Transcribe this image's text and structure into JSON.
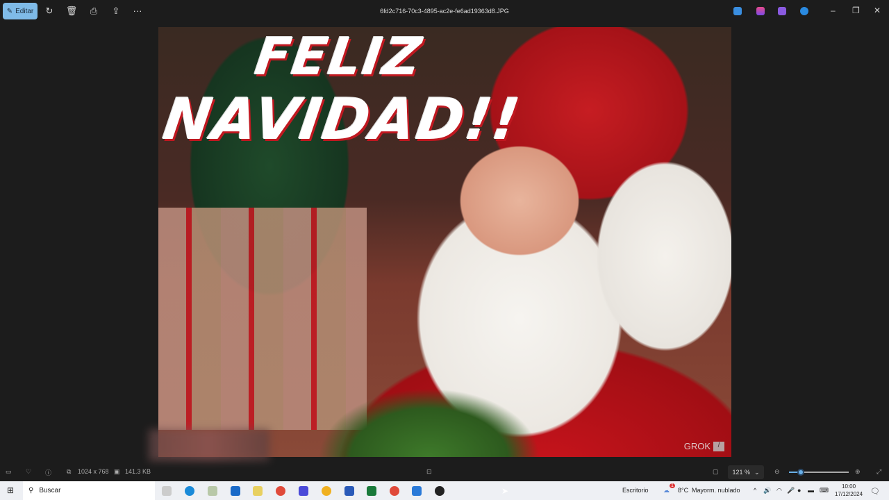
{
  "toolbar": {
    "edit_label": "Editar",
    "file_title": "6fd2c716-70c3-4895-ac2e-fe6ad19363d8.JPG"
  },
  "image": {
    "line1": "FELIZ",
    "line2": "NAVIDAD!!",
    "watermark": "GROK"
  },
  "status": {
    "dimensions": "1024 x 768",
    "file_size": "141.3 KB",
    "zoom": "121 %",
    "zoom_fraction": 0.2
  },
  "taskbar": {
    "search_placeholder": "Buscar",
    "desktop_label": "Escritorio",
    "weather_temp": "8°C",
    "weather_text": "Mayorm. nublado",
    "weather_badge": "1",
    "time": "10:00",
    "date": "17/12/2024"
  },
  "colors": {
    "accent": "#7fbbe8",
    "bg": "#1c1c1c"
  }
}
